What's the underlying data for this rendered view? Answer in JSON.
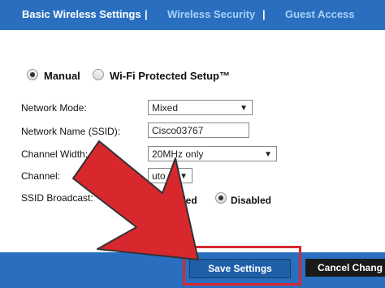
{
  "tabs": [
    {
      "label": "Basic Wireless Settings",
      "active": true
    },
    {
      "label": "Wireless Security",
      "active": false
    },
    {
      "label": "Guest Access",
      "active": false
    }
  ],
  "separator": "|",
  "mode_options": {
    "manual": {
      "label": "Manual",
      "selected": true
    },
    "wps": {
      "label": "Wi-Fi Protected Setup™",
      "selected": false
    }
  },
  "fields": {
    "network_mode": {
      "label": "Network Mode:",
      "value": "Mixed"
    },
    "ssid": {
      "label": "Network Name (SSID):",
      "value": "Cisco03767"
    },
    "channel_width": {
      "label": "Channel Width:",
      "value": "20MHz only"
    },
    "channel": {
      "label": "Channel:",
      "value": "uto"
    },
    "ssid_broadcast": {
      "label": "SSID Broadcast:",
      "enabled_label": "nabled",
      "disabled_label": "Disabled",
      "selected": "disabled"
    }
  },
  "footer": {
    "save_label": "Save Settings",
    "cancel_label": "Cancel Chang"
  },
  "colors": {
    "header_blue": "#2a6fbf",
    "arrow_red": "#d9272e",
    "highlight_red": "#d9272e"
  }
}
